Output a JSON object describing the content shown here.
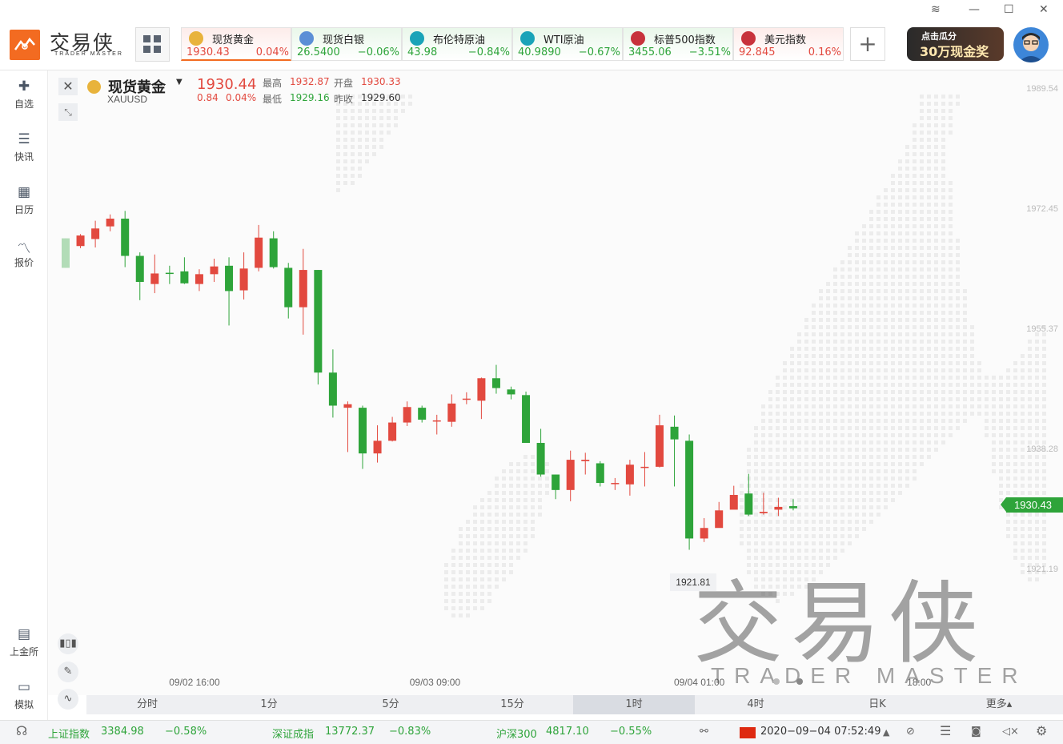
{
  "window": {
    "minimize": "—",
    "maximize": "☐",
    "close": "✕",
    "layers": "≋"
  },
  "brand": {
    "name": "交易侠",
    "sub": "TRADER MASTER"
  },
  "quote_tabs": [
    {
      "name": "现货黄金",
      "price": "1930.43",
      "change": "0.04%",
      "dir": "up",
      "icon_color": "#e8b33c"
    },
    {
      "name": "现货白银",
      "price": "26.5400",
      "change": "−0.06%",
      "dir": "down",
      "icon_color": "#5b8fd6"
    },
    {
      "name": "布伦特原油",
      "price": "43.98",
      "change": "−0.84%",
      "dir": "down",
      "icon_color": "#1aa3b8"
    },
    {
      "name": "WTI原油",
      "price": "40.9890",
      "change": "−0.67%",
      "dir": "down",
      "icon_color": "#1aa3b8"
    },
    {
      "name": "标普500指数",
      "price": "3455.06",
      "change": "−3.51%",
      "dir": "down",
      "icon_color": "#c8323c"
    },
    {
      "name": "美元指数",
      "price": "92.845",
      "change": "0.16%",
      "dir": "up",
      "icon_color": "#c8323c"
    }
  ],
  "add_tab": "+",
  "promo": {
    "line1": "点击瓜分",
    "line2": "30万现金奖"
  },
  "sidebar": [
    {
      "label": "自选",
      "icon": "bookmark-plus-icon"
    },
    {
      "label": "快讯",
      "icon": "news-list-icon"
    },
    {
      "label": "日历",
      "icon": "calendar-icon"
    },
    {
      "label": "报价",
      "icon": "trend-line-icon"
    },
    {
      "label": "上金所",
      "icon": "exchange-building-icon"
    },
    {
      "label": "模拟",
      "icon": "wallet-icon"
    }
  ],
  "symbol": {
    "name": "现货黄金",
    "code": "XAUUSD",
    "price": "1930.44",
    "change": "0.84",
    "change_pct": "0.04%",
    "high_label": "最高",
    "high": "1932.87",
    "open_label": "开盘",
    "open": "1930.33",
    "low_label": "最低",
    "low": "1929.16",
    "prev_label": "昨收",
    "prev": "1929.60"
  },
  "current_price_tag": "1930.43",
  "low_marker": "1921.81",
  "watermark": {
    "cn": "交易侠",
    "en": "TRADER MASTER"
  },
  "timeframes": [
    "分时",
    "1分",
    "5分",
    "15分",
    "1时",
    "4时",
    "日K",
    "更多▴"
  ],
  "active_timeframe": "1时",
  "chart_data": {
    "type": "candlestick",
    "y_ticks": [
      "1989.54",
      "1972.45",
      "1955.37",
      "1938.28",
      "1921.19"
    ],
    "ylim": [
      1921.19,
      1989.54
    ],
    "x_ticks": [
      "09/02 16:00",
      "09/03 09:00",
      "09/04 01:00",
      "18:00"
    ],
    "candles": [
      {
        "o": 1968.4,
        "c": 1964.2,
        "h": 1968.4,
        "l": 1964.2
      },
      {
        "o": 1967.3,
        "c": 1968.8,
        "h": 1969.0,
        "l": 1967.0
      },
      {
        "o": 1968.3,
        "c": 1969.8,
        "h": 1970.9,
        "l": 1967.1
      },
      {
        "o": 1970.1,
        "c": 1971.2,
        "h": 1971.8,
        "l": 1969.4
      },
      {
        "o": 1971.2,
        "c": 1965.9,
        "h": 1972.3,
        "l": 1964.3
      },
      {
        "o": 1965.9,
        "c": 1962.2,
        "h": 1966.4,
        "l": 1959.6
      },
      {
        "o": 1961.9,
        "c": 1963.4,
        "h": 1966.1,
        "l": 1960.6
      },
      {
        "o": 1963.5,
        "c": 1963.4,
        "h": 1964.5,
        "l": 1961.9
      },
      {
        "o": 1963.7,
        "c": 1962.0,
        "h": 1965.7,
        "l": 1961.9
      },
      {
        "o": 1961.9,
        "c": 1963.3,
        "h": 1964.0,
        "l": 1960.9
      },
      {
        "o": 1963.3,
        "c": 1964.4,
        "h": 1965.5,
        "l": 1962.2
      },
      {
        "o": 1964.5,
        "c": 1960.9,
        "h": 1965.7,
        "l": 1956.0
      },
      {
        "o": 1961.0,
        "c": 1964.1,
        "h": 1966.4,
        "l": 1959.7
      },
      {
        "o": 1964.2,
        "c": 1968.5,
        "h": 1970.3,
        "l": 1963.7
      },
      {
        "o": 1968.4,
        "c": 1964.3,
        "h": 1969.4,
        "l": 1964.1
      },
      {
        "o": 1964.2,
        "c": 1958.6,
        "h": 1964.9,
        "l": 1957.0
      },
      {
        "o": 1958.6,
        "c": 1963.9,
        "h": 1966.9,
        "l": 1954.7
      },
      {
        "o": 1963.9,
        "c": 1949.3,
        "h": 1963.9,
        "l": 1947.6
      },
      {
        "o": 1949.3,
        "c": 1944.6,
        "h": 1952.6,
        "l": 1942.9
      },
      {
        "o": 1944.3,
        "c": 1944.8,
        "h": 1945.2,
        "l": 1938.0
      },
      {
        "o": 1944.3,
        "c": 1937.8,
        "h": 1944.6,
        "l": 1935.6
      },
      {
        "o": 1937.8,
        "c": 1939.6,
        "h": 1941.8,
        "l": 1936.5
      },
      {
        "o": 1939.6,
        "c": 1942.2,
        "h": 1943.0,
        "l": 1939.5
      },
      {
        "o": 1942.2,
        "c": 1944.4,
        "h": 1945.2,
        "l": 1941.7
      },
      {
        "o": 1944.3,
        "c": 1942.6,
        "h": 1944.6,
        "l": 1942.2
      },
      {
        "o": 1942.5,
        "c": 1942.5,
        "h": 1943.3,
        "l": 1940.5
      },
      {
        "o": 1942.3,
        "c": 1944.9,
        "h": 1946.2,
        "l": 1941.6
      },
      {
        "o": 1945.5,
        "c": 1945.6,
        "h": 1946.5,
        "l": 1944.8
      },
      {
        "o": 1945.3,
        "c": 1948.5,
        "h": 1948.6,
        "l": 1942.7
      },
      {
        "o": 1948.5,
        "c": 1947.1,
        "h": 1950.4,
        "l": 1946.3
      },
      {
        "o": 1946.9,
        "c": 1946.2,
        "h": 1947.3,
        "l": 1945.5
      },
      {
        "o": 1946.1,
        "c": 1939.3,
        "h": 1946.6,
        "l": 1939.3
      },
      {
        "o": 1939.3,
        "c": 1934.8,
        "h": 1941.3,
        "l": 1934.5
      },
      {
        "o": 1934.8,
        "c": 1932.6,
        "h": 1934.8,
        "l": 1931.3
      },
      {
        "o": 1932.6,
        "c": 1936.9,
        "h": 1938.2,
        "l": 1931.0
      },
      {
        "o": 1936.7,
        "c": 1936.9,
        "h": 1937.9,
        "l": 1934.8
      },
      {
        "o": 1936.4,
        "c": 1933.6,
        "h": 1936.7,
        "l": 1933.1
      },
      {
        "o": 1933.5,
        "c": 1933.6,
        "h": 1934.3,
        "l": 1932.6
      },
      {
        "o": 1933.4,
        "c": 1936.2,
        "h": 1936.9,
        "l": 1931.8
      },
      {
        "o": 1935.8,
        "c": 1935.9,
        "h": 1938.0,
        "l": 1933.1
      },
      {
        "o": 1935.9,
        "c": 1941.8,
        "h": 1943.3,
        "l": 1935.8
      },
      {
        "o": 1941.6,
        "c": 1939.8,
        "h": 1943.2,
        "l": 1933.1
      },
      {
        "o": 1939.6,
        "c": 1925.7,
        "h": 1940.5,
        "l": 1924.1
      },
      {
        "o": 1925.7,
        "c": 1927.2,
        "h": 1928.6,
        "l": 1925.2
      },
      {
        "o": 1927.2,
        "c": 1929.7,
        "h": 1930.9,
        "l": 1927.3
      },
      {
        "o": 1929.8,
        "c": 1931.9,
        "h": 1933.2,
        "l": 1929.9
      },
      {
        "o": 1932.1,
        "c": 1929.1,
        "h": 1934.9,
        "l": 1928.9
      },
      {
        "o": 1929.3,
        "c": 1929.5,
        "h": 1932.2,
        "l": 1929.1
      },
      {
        "o": 1929.8,
        "c": 1930.2,
        "h": 1931.5,
        "l": 1928.9
      },
      {
        "o": 1930.3,
        "c": 1930.0,
        "h": 1931.3,
        "l": 1929.7
      }
    ]
  },
  "statusbar": {
    "idx1_name": "上证指数",
    "idx1_val": "3384.98",
    "idx1_chg": "−0.58%",
    "idx2_name": "深证成指",
    "idx2_val": "13772.37",
    "idx2_chg": "−0.83%",
    "idx3_name": "沪深300",
    "idx3_val": "4817.10",
    "idx3_chg": "−0.55%",
    "datetime": "2020−09−04 07:52:49"
  },
  "colors": {
    "up": "#e2493f",
    "down": "#2ea43a",
    "accent": "#f36b21"
  }
}
